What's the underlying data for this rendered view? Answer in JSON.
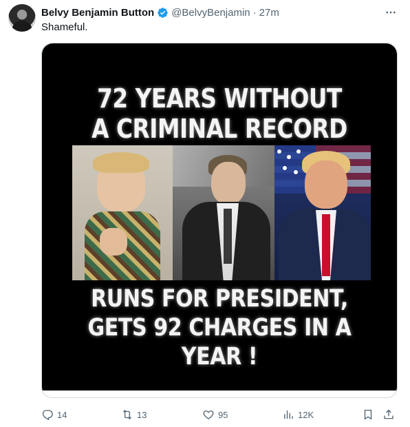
{
  "tweet": {
    "author_name": "Belvy Benjamin Button",
    "handle": "@BelvyBenjamin",
    "separator": "·",
    "time": "27m",
    "text": "Shameful."
  },
  "media": {
    "headline_top_line1": "72 YEARS WITHOUT",
    "headline_top_line2": "A CRIMINAL RECORD",
    "headline_bottom_line1": "RUNS FOR PRESIDENT,",
    "headline_bottom_line2": "GETS 92 CHARGES IN A YEAR !"
  },
  "actions": {
    "replies": "14",
    "reposts": "13",
    "likes": "95",
    "views": "12K"
  },
  "icons": {
    "verified": "verified-badge-icon",
    "more": "more-icon",
    "reply": "reply-icon",
    "repost": "repost-icon",
    "like": "like-icon",
    "views": "views-icon",
    "bookmark": "bookmark-icon",
    "share": "share-icon"
  },
  "colors": {
    "verified": "#1d9bf0",
    "text_primary": "#0f1419",
    "text_secondary": "#536471",
    "border": "#cfd9de"
  }
}
